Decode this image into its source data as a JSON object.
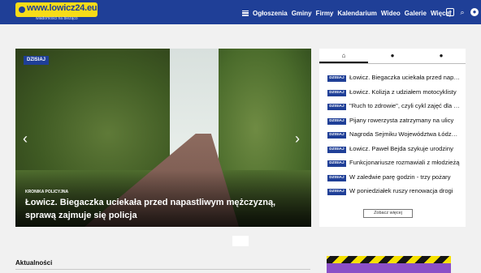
{
  "header": {
    "logo_text": "www.lowicz24.eu",
    "logo_tagline": "wiadomości na bieżąco",
    "menu_icon": "hamburger-icon",
    "nav": [
      "Ogłoszenia",
      "Gminy",
      "Firmy",
      "Kalendarium",
      "Wideo",
      "Galerie",
      "Więcej"
    ],
    "icons": [
      "add-icon",
      "search-icon",
      "user-icon"
    ]
  },
  "featured": {
    "tag": "DZISIAJ",
    "category": "KRONIKA POLICYJNA",
    "title": "Łowicz. Biegaczka uciekała przed napastliwym mężczyzną, sprawą zajmuje się policja",
    "arrows": {
      "left": "‹",
      "right": "›"
    }
  },
  "sidebar": {
    "tabs": [
      {
        "icon": "home-icon",
        "glyph": "⌂"
      },
      {
        "icon": "fire-icon",
        "glyph": "●"
      },
      {
        "icon": "chat-icon",
        "glyph": "●"
      }
    ],
    "items": [
      {
        "badge": "DZISIAJ",
        "text": "Łowicz. Biegaczka uciekała przed napastliwym mężczyzną"
      },
      {
        "badge": "DZISIAJ",
        "text": "Łowicz. Kolizja z udziałem motocyklisty"
      },
      {
        "badge": "DZISIAJ",
        "text": "\"Ruch to zdrowie\", czyli cykl zajęć dla seniorów"
      },
      {
        "badge": "DZISIAJ",
        "text": "Pijany rowerzysta zatrzymany na ulicy"
      },
      {
        "badge": "DZISIAJ",
        "text": "Nagroda Sejmiku Województwa Łódzkiego"
      },
      {
        "badge": "DZISIAJ",
        "text": "Łowicz. Paweł Bejda szykuje urodziny"
      },
      {
        "badge": "DZISIAJ",
        "text": "Funkcjonariusze rozmawiali z młodzieżą"
      },
      {
        "badge": "DZISIAJ",
        "text": "W zaledwie parę godzin - trzy pożary"
      },
      {
        "badge": "DZISIAJ",
        "text": "W poniedziałek ruszy renowacja drogi"
      }
    ],
    "more_label": "Zobacz więcej"
  },
  "section": {
    "title": "Aktualności"
  }
}
